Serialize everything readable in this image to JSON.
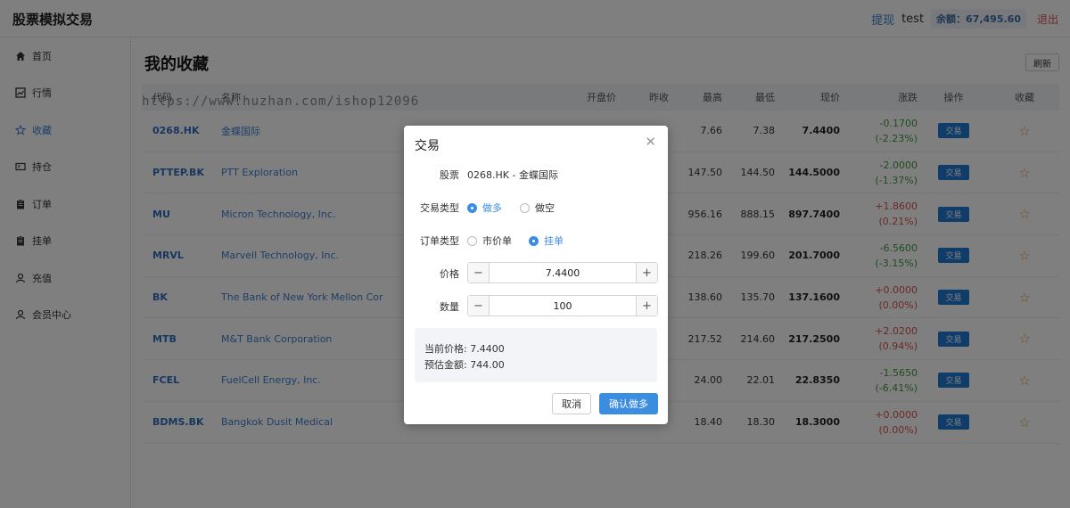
{
  "header": {
    "brand": "股票模拟交易",
    "withdraw": "提现",
    "user": "test",
    "balance": "余额：67,495.60",
    "logout": "退出"
  },
  "sidebar": {
    "items": [
      {
        "label": "首页",
        "icon": "home-icon"
      },
      {
        "label": "行情",
        "icon": "chart-icon"
      },
      {
        "label": "收藏",
        "icon": "star-icon"
      },
      {
        "label": "持仓",
        "icon": "wallet-icon"
      },
      {
        "label": "订单",
        "icon": "clipboard-icon"
      },
      {
        "label": "挂单",
        "icon": "clipboard-icon"
      },
      {
        "label": "充值",
        "icon": "user-icon"
      },
      {
        "label": "会员中心",
        "icon": "user-icon"
      }
    ]
  },
  "main": {
    "title": "我的收藏",
    "refresh": "刷新",
    "watermark": "https://www.huzhan.com/ishop12096",
    "columns": {
      "code": "代码",
      "name": "名称",
      "open": "开盘价",
      "prev": "昨收",
      "high": "最高",
      "low": "最低",
      "cur": "现价",
      "chg": "涨跌",
      "op": "操作",
      "fav": "收藏"
    },
    "trade_label": "交易",
    "rows": [
      {
        "code": "0268.HK",
        "name": "金蝶国际",
        "open": "",
        "prev": "",
        "high": "7.66",
        "low": "7.38",
        "cur": "7.4400",
        "chg": "-0.1700",
        "pct": "(-2.23%)",
        "dir": "green"
      },
      {
        "code": "PTTEP.BK",
        "name": "PTT Exploration",
        "open": "",
        "prev": "",
        "high": "147.50",
        "low": "144.50",
        "cur": "144.5000",
        "chg": "-2.0000",
        "pct": "(-1.37%)",
        "dir": "green"
      },
      {
        "code": "MU",
        "name": "Micron Technology, Inc.",
        "open": "",
        "prev": "",
        "high": "956.16",
        "low": "888.15",
        "cur": "897.7400",
        "chg": "+1.8600",
        "pct": "(0.21%)",
        "dir": "red"
      },
      {
        "code": "MRVL",
        "name": "Marvell Technology, Inc.",
        "open": "",
        "prev": "",
        "high": "218.26",
        "low": "199.60",
        "cur": "201.7000",
        "chg": "-6.5600",
        "pct": "(-3.15%)",
        "dir": "green"
      },
      {
        "code": "BK",
        "name": "The Bank of New York Mellon Cor",
        "open": "",
        "prev": "",
        "high": "138.60",
        "low": "135.70",
        "cur": "137.1600",
        "chg": "+0.0000",
        "pct": "(0.00%)",
        "dir": "red"
      },
      {
        "code": "MTB",
        "name": "M&T Bank Corporation",
        "open": "",
        "prev": "",
        "high": "217.52",
        "low": "214.60",
        "cur": "217.2500",
        "chg": "+2.0200",
        "pct": "(0.94%)",
        "dir": "red"
      },
      {
        "code": "FCEL",
        "name": "FuelCell Energy, Inc.",
        "open": "",
        "prev": "",
        "high": "24.00",
        "low": "22.01",
        "cur": "22.8350",
        "chg": "-1.5650",
        "pct": "(-6.41%)",
        "dir": "green"
      },
      {
        "code": "BDMS.BK",
        "name": "Bangkok Dusit Medical",
        "open": "",
        "prev": "",
        "high": "18.40",
        "low": "18.30",
        "cur": "18.3000",
        "chg": "+0.0000",
        "pct": "(0.00%)",
        "dir": "red"
      }
    ]
  },
  "modal": {
    "title": "交易",
    "stock_label": "股票",
    "stock_value": "0268.HK - 金蝶国际",
    "trade_type_label": "交易类型",
    "trade_long": "做多",
    "trade_short": "做空",
    "order_type_label": "订单类型",
    "order_market": "市价单",
    "order_limit": "挂单",
    "price_label": "价格",
    "price_value": "7.4400",
    "qty_label": "数量",
    "qty_value": "100",
    "current_price": "当前价格: 7.4400",
    "est_amount": "预估金额: 744.00",
    "cancel": "取消",
    "confirm": "确认做多"
  },
  "colors": {
    "accent": "#3b8de0",
    "up": "#d9534f",
    "down": "#3d9a3d"
  }
}
